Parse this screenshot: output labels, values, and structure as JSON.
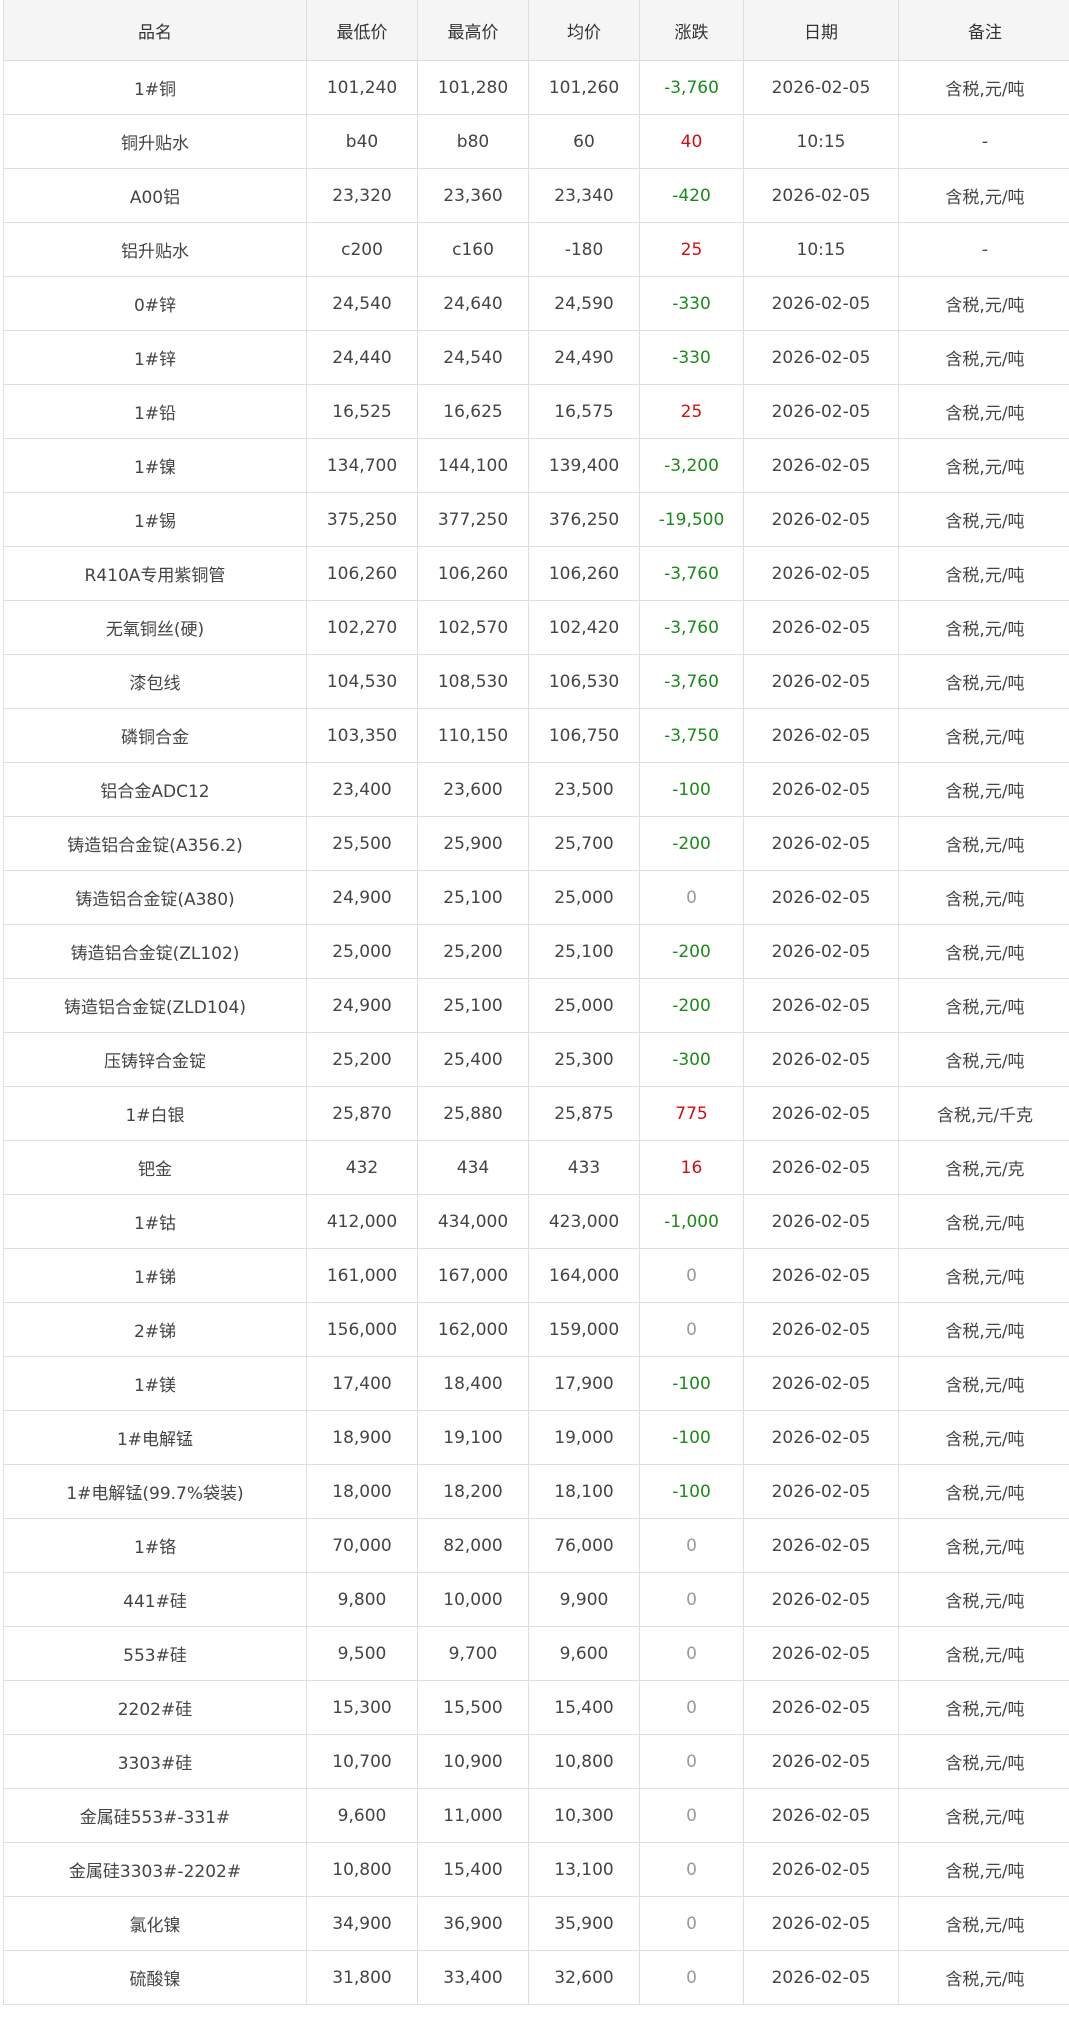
{
  "table": {
    "columns": [
      "品名",
      "最低价",
      "最高价",
      "均价",
      "涨跌",
      "日期",
      "备注"
    ],
    "rows": [
      {
        "name": "1#铜",
        "low": "101,240",
        "high": "101,280",
        "avg": "101,260",
        "change": "-3,760",
        "date": "2026-02-05",
        "note": "含税,元/吨",
        "trend": "down"
      },
      {
        "name": "铜升贴水",
        "low": "b40",
        "high": "b80",
        "avg": "60",
        "change": "40",
        "date": "10:15",
        "note": "-",
        "trend": "up"
      },
      {
        "name": "A00铝",
        "low": "23,320",
        "high": "23,360",
        "avg": "23,340",
        "change": "-420",
        "date": "2026-02-05",
        "note": "含税,元/吨",
        "trend": "down"
      },
      {
        "name": "铝升贴水",
        "low": "c200",
        "high": "c160",
        "avg": "-180",
        "change": "25",
        "date": "10:15",
        "note": "-",
        "trend": "up"
      },
      {
        "name": "0#锌",
        "low": "24,540",
        "high": "24,640",
        "avg": "24,590",
        "change": "-330",
        "date": "2026-02-05",
        "note": "含税,元/吨",
        "trend": "down"
      },
      {
        "name": "1#锌",
        "low": "24,440",
        "high": "24,540",
        "avg": "24,490",
        "change": "-330",
        "date": "2026-02-05",
        "note": "含税,元/吨",
        "trend": "down"
      },
      {
        "name": "1#铅",
        "low": "16,525",
        "high": "16,625",
        "avg": "16,575",
        "change": "25",
        "date": "2026-02-05",
        "note": "含税,元/吨",
        "trend": "up"
      },
      {
        "name": "1#镍",
        "low": "134,700",
        "high": "144,100",
        "avg": "139,400",
        "change": "-3,200",
        "date": "2026-02-05",
        "note": "含税,元/吨",
        "trend": "down"
      },
      {
        "name": "1#锡",
        "low": "375,250",
        "high": "377,250",
        "avg": "376,250",
        "change": "-19,500",
        "date": "2026-02-05",
        "note": "含税,元/吨",
        "trend": "down"
      },
      {
        "name": "R410A专用紫铜管",
        "low": "106,260",
        "high": "106,260",
        "avg": "106,260",
        "change": "-3,760",
        "date": "2026-02-05",
        "note": "含税,元/吨",
        "trend": "down"
      },
      {
        "name": "无氧铜丝(硬)",
        "low": "102,270",
        "high": "102,570",
        "avg": "102,420",
        "change": "-3,760",
        "date": "2026-02-05",
        "note": "含税,元/吨",
        "trend": "down"
      },
      {
        "name": "漆包线",
        "low": "104,530",
        "high": "108,530",
        "avg": "106,530",
        "change": "-3,760",
        "date": "2026-02-05",
        "note": "含税,元/吨",
        "trend": "down"
      },
      {
        "name": "磷铜合金",
        "low": "103,350",
        "high": "110,150",
        "avg": "106,750",
        "change": "-3,750",
        "date": "2026-02-05",
        "note": "含税,元/吨",
        "trend": "down"
      },
      {
        "name": "铝合金ADC12",
        "low": "23,400",
        "high": "23,600",
        "avg": "23,500",
        "change": "-100",
        "date": "2026-02-05",
        "note": "含税,元/吨",
        "trend": "down"
      },
      {
        "name": "铸造铝合金锭(A356.2)",
        "low": "25,500",
        "high": "25,900",
        "avg": "25,700",
        "change": "-200",
        "date": "2026-02-05",
        "note": "含税,元/吨",
        "trend": "down"
      },
      {
        "name": "铸造铝合金锭(A380)",
        "low": "24,900",
        "high": "25,100",
        "avg": "25,000",
        "change": "0",
        "date": "2026-02-05",
        "note": "含税,元/吨",
        "trend": "flat"
      },
      {
        "name": "铸造铝合金锭(ZL102)",
        "low": "25,000",
        "high": "25,200",
        "avg": "25,100",
        "change": "-200",
        "date": "2026-02-05",
        "note": "含税,元/吨",
        "trend": "down"
      },
      {
        "name": "铸造铝合金锭(ZLD104)",
        "low": "24,900",
        "high": "25,100",
        "avg": "25,000",
        "change": "-200",
        "date": "2026-02-05",
        "note": "含税,元/吨",
        "trend": "down"
      },
      {
        "name": "压铸锌合金锭",
        "low": "25,200",
        "high": "25,400",
        "avg": "25,300",
        "change": "-300",
        "date": "2026-02-05",
        "note": "含税,元/吨",
        "trend": "down"
      },
      {
        "name": "1#白银",
        "low": "25,870",
        "high": "25,880",
        "avg": "25,875",
        "change": "775",
        "date": "2026-02-05",
        "note": "含税,元/千克",
        "trend": "up"
      },
      {
        "name": "钯金",
        "low": "432",
        "high": "434",
        "avg": "433",
        "change": "16",
        "date": "2026-02-05",
        "note": "含税,元/克",
        "trend": "up"
      },
      {
        "name": "1#钴",
        "low": "412,000",
        "high": "434,000",
        "avg": "423,000",
        "change": "-1,000",
        "date": "2026-02-05",
        "note": "含税,元/吨",
        "trend": "down"
      },
      {
        "name": "1#锑",
        "low": "161,000",
        "high": "167,000",
        "avg": "164,000",
        "change": "0",
        "date": "2026-02-05",
        "note": "含税,元/吨",
        "trend": "flat"
      },
      {
        "name": "2#锑",
        "low": "156,000",
        "high": "162,000",
        "avg": "159,000",
        "change": "0",
        "date": "2026-02-05",
        "note": "含税,元/吨",
        "trend": "flat"
      },
      {
        "name": "1#镁",
        "low": "17,400",
        "high": "18,400",
        "avg": "17,900",
        "change": "-100",
        "date": "2026-02-05",
        "note": "含税,元/吨",
        "trend": "down"
      },
      {
        "name": "1#电解锰",
        "low": "18,900",
        "high": "19,100",
        "avg": "19,000",
        "change": "-100",
        "date": "2026-02-05",
        "note": "含税,元/吨",
        "trend": "down"
      },
      {
        "name": "1#电解锰(99.7%袋装)",
        "low": "18,000",
        "high": "18,200",
        "avg": "18,100",
        "change": "-100",
        "date": "2026-02-05",
        "note": "含税,元/吨",
        "trend": "down"
      },
      {
        "name": "1#铬",
        "low": "70,000",
        "high": "82,000",
        "avg": "76,000",
        "change": "0",
        "date": "2026-02-05",
        "note": "含税,元/吨",
        "trend": "flat"
      },
      {
        "name": "441#硅",
        "low": "9,800",
        "high": "10,000",
        "avg": "9,900",
        "change": "0",
        "date": "2026-02-05",
        "note": "含税,元/吨",
        "trend": "flat"
      },
      {
        "name": "553#硅",
        "low": "9,500",
        "high": "9,700",
        "avg": "9,600",
        "change": "0",
        "date": "2026-02-05",
        "note": "含税,元/吨",
        "trend": "flat"
      },
      {
        "name": "2202#硅",
        "low": "15,300",
        "high": "15,500",
        "avg": "15,400",
        "change": "0",
        "date": "2026-02-05",
        "note": "含税,元/吨",
        "trend": "flat"
      },
      {
        "name": "3303#硅",
        "low": "10,700",
        "high": "10,900",
        "avg": "10,800",
        "change": "0",
        "date": "2026-02-05",
        "note": "含税,元/吨",
        "trend": "flat"
      },
      {
        "name": "金属硅553#-331#",
        "low": "9,600",
        "high": "11,000",
        "avg": "10,300",
        "change": "0",
        "date": "2026-02-05",
        "note": "含税,元/吨",
        "trend": "flat"
      },
      {
        "name": "金属硅3303#-2202#",
        "low": "10,800",
        "high": "15,400",
        "avg": "13,100",
        "change": "0",
        "date": "2026-02-05",
        "note": "含税,元/吨",
        "trend": "flat"
      },
      {
        "name": "氯化镍",
        "low": "34,900",
        "high": "36,900",
        "avg": "35,900",
        "change": "0",
        "date": "2026-02-05",
        "note": "含税,元/吨",
        "trend": "flat"
      },
      {
        "name": "硫酸镍",
        "low": "31,800",
        "high": "33,400",
        "avg": "32,600",
        "change": "0",
        "date": "2026-02-05",
        "note": "含税,元/吨",
        "trend": "flat"
      }
    ]
  },
  "colors": {
    "down": "#1a8a1a",
    "up": "#d01010",
    "flat": "#9a9a9a",
    "header_bg": "#f5f5f5",
    "border": "#dedede"
  }
}
